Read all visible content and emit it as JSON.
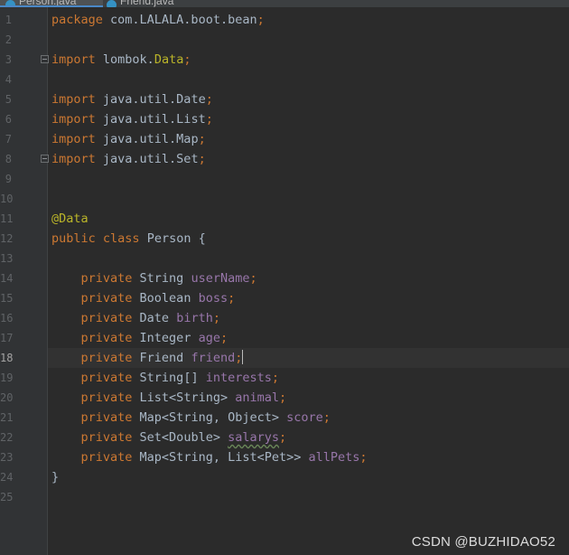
{
  "tabs": [
    {
      "label": "Person.java",
      "active": true
    },
    {
      "label": "Friend.java",
      "active": false
    }
  ],
  "editor": {
    "current_line": 18,
    "lines": [
      {
        "n": "1",
        "tokens": [
          {
            "t": "package ",
            "c": "kw"
          },
          {
            "t": "com.LALALA.boot.bean",
            "c": ""
          },
          {
            "t": ";",
            "c": "kw"
          }
        ]
      },
      {
        "n": "2",
        "tokens": []
      },
      {
        "n": "3",
        "fold": true,
        "tokens": [
          {
            "t": "import ",
            "c": "kw"
          },
          {
            "t": "lombok.",
            "c": ""
          },
          {
            "t": "Data",
            "c": "ann"
          },
          {
            "t": ";",
            "c": "kw"
          }
        ]
      },
      {
        "n": "4",
        "tokens": []
      },
      {
        "n": "5",
        "tokens": [
          {
            "t": "import ",
            "c": "kw"
          },
          {
            "t": "java.util.Date",
            "c": ""
          },
          {
            "t": ";",
            "c": "kw"
          }
        ]
      },
      {
        "n": "6",
        "tokens": [
          {
            "t": "import ",
            "c": "kw"
          },
          {
            "t": "java.util.List",
            "c": ""
          },
          {
            "t": ";",
            "c": "kw"
          }
        ]
      },
      {
        "n": "7",
        "tokens": [
          {
            "t": "import ",
            "c": "kw"
          },
          {
            "t": "java.util.Map",
            "c": ""
          },
          {
            "t": ";",
            "c": "kw"
          }
        ]
      },
      {
        "n": "8",
        "fold": true,
        "tokens": [
          {
            "t": "import ",
            "c": "kw"
          },
          {
            "t": "java.util.Set",
            "c": ""
          },
          {
            "t": ";",
            "c": "kw"
          }
        ]
      },
      {
        "n": "9",
        "tokens": []
      },
      {
        "n": "10",
        "tokens": []
      },
      {
        "n": "11",
        "tokens": [
          {
            "t": "@Data",
            "c": "ann"
          }
        ]
      },
      {
        "n": "12",
        "tokens": [
          {
            "t": "public ",
            "c": "kw"
          },
          {
            "t": "class ",
            "c": "kw"
          },
          {
            "t": "Person {",
            "c": ""
          }
        ]
      },
      {
        "n": "13",
        "tokens": []
      },
      {
        "n": "14",
        "tokens": [
          {
            "t": "    private ",
            "c": "kw"
          },
          {
            "t": "String ",
            "c": ""
          },
          {
            "t": "userName",
            "c": "fld"
          },
          {
            "t": ";",
            "c": "kw"
          }
        ]
      },
      {
        "n": "15",
        "tokens": [
          {
            "t": "    private ",
            "c": "kw"
          },
          {
            "t": "Boolean ",
            "c": ""
          },
          {
            "t": "boss",
            "c": "fld"
          },
          {
            "t": ";",
            "c": "kw"
          }
        ]
      },
      {
        "n": "16",
        "tokens": [
          {
            "t": "    private ",
            "c": "kw"
          },
          {
            "t": "Date ",
            "c": ""
          },
          {
            "t": "birth",
            "c": "fld"
          },
          {
            "t": ";",
            "c": "kw"
          }
        ]
      },
      {
        "n": "17",
        "tokens": [
          {
            "t": "    private ",
            "c": "kw"
          },
          {
            "t": "Integer ",
            "c": ""
          },
          {
            "t": "age",
            "c": "fld"
          },
          {
            "t": ";",
            "c": "kw"
          }
        ]
      },
      {
        "n": "18",
        "caret": true,
        "tokens": [
          {
            "t": "    private ",
            "c": "kw"
          },
          {
            "t": "Friend ",
            "c": ""
          },
          {
            "t": "friend",
            "c": "fld"
          },
          {
            "t": ";",
            "c": "kw"
          }
        ]
      },
      {
        "n": "19",
        "tokens": [
          {
            "t": "    private ",
            "c": "kw"
          },
          {
            "t": "String[] ",
            "c": ""
          },
          {
            "t": "interests",
            "c": "fld"
          },
          {
            "t": ";",
            "c": "kw"
          }
        ]
      },
      {
        "n": "20",
        "tokens": [
          {
            "t": "    private ",
            "c": "kw"
          },
          {
            "t": "List<String> ",
            "c": ""
          },
          {
            "t": "animal",
            "c": "fld"
          },
          {
            "t": ";",
            "c": "kw"
          }
        ]
      },
      {
        "n": "21",
        "tokens": [
          {
            "t": "    private ",
            "c": "kw"
          },
          {
            "t": "Map<String, Object> ",
            "c": ""
          },
          {
            "t": "score",
            "c": "fld"
          },
          {
            "t": ";",
            "c": "kw"
          }
        ]
      },
      {
        "n": "22",
        "tokens": [
          {
            "t": "    private ",
            "c": "kw"
          },
          {
            "t": "Set<Double> ",
            "c": ""
          },
          {
            "t": "salarys",
            "c": "fld typo"
          },
          {
            "t": ";",
            "c": "kw"
          }
        ]
      },
      {
        "n": "23",
        "tokens": [
          {
            "t": "    private ",
            "c": "kw"
          },
          {
            "t": "Map<String, List<Pet>> ",
            "c": ""
          },
          {
            "t": "allPets",
            "c": "fld"
          },
          {
            "t": ";",
            "c": "kw"
          }
        ]
      },
      {
        "n": "24",
        "tokens": [
          {
            "t": "}",
            "c": ""
          }
        ]
      },
      {
        "n": "25",
        "tokens": []
      }
    ]
  },
  "watermark": "CSDN @BUZHIDAO52",
  "colors": {
    "background": "#2b2b2b",
    "gutter": "#313335",
    "keyword": "#cc7832",
    "annotation": "#bbb529",
    "field": "#9876aa",
    "text": "#a9b7c6"
  }
}
